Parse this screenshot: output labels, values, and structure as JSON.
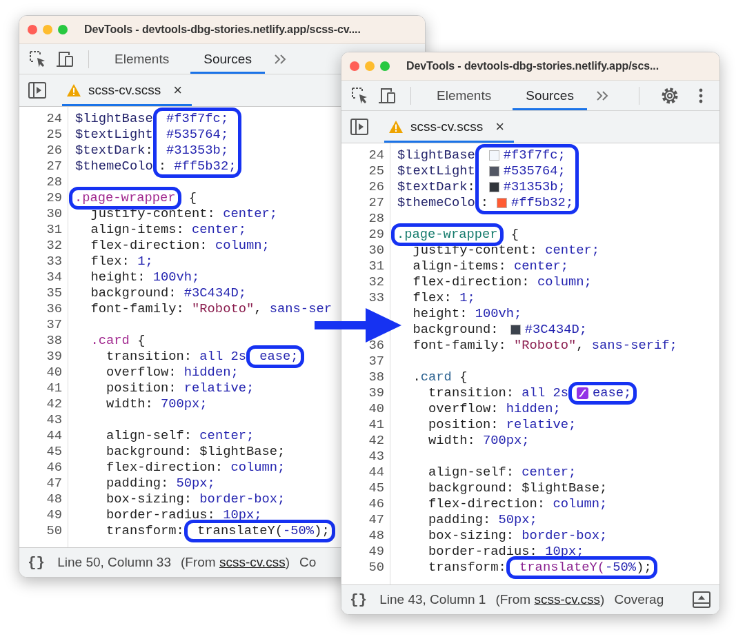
{
  "windows": [
    {
      "title": "DevTools - devtools-dbg-stories.netlify.app/scss-cv....",
      "toolbar_tabs": [
        {
          "label": "Elements",
          "selected": false
        },
        {
          "label": "Sources",
          "selected": true
        }
      ],
      "file_tab": {
        "name": "scss-cv.scss",
        "close": "×"
      },
      "lines": [
        {
          "number": "24",
          "code": [
            {
              "text": "$lightBase",
              "kind": "variable"
            }
          ],
          "highlighted": [
            {
              "text": " #f3f7fc;",
              "kind": "value"
            }
          ]
        },
        {
          "number": "25",
          "code": [
            {
              "text": "$textLight",
              "kind": "variable"
            }
          ],
          "highlighted": [
            {
              "text": " #535764;",
              "kind": "value"
            }
          ]
        },
        {
          "number": "26",
          "code": [
            {
              "text": "$textDark",
              "kind": "variable"
            },
            {
              "text": ":",
              "kind": "plain"
            }
          ],
          "highlighted": [
            {
              "text": " #31353b;",
              "kind": "value"
            }
          ]
        },
        {
          "number": "27",
          "code": [
            {
              "text": "$themeColo",
              "kind": "variable"
            }
          ],
          "highlighted": [
            {
              "text": ": ",
              "kind": "plain"
            },
            {
              "text": "#ff5b32;",
              "kind": "value"
            }
          ]
        },
        {
          "number": "28"
        },
        {
          "number": "29",
          "highlighted": [
            {
              "text": ".page-wrapper",
              "kind": "selector"
            }
          ],
          "rest": [
            {
              "text": " {",
              "kind": "plain"
            }
          ]
        },
        {
          "number": "30",
          "code": [
            {
              "text": "  justify-content: ",
              "kind": "plain"
            },
            {
              "text": "center;",
              "kind": "value"
            }
          ]
        },
        {
          "number": "31",
          "code": [
            {
              "text": "  align-items: ",
              "kind": "plain"
            },
            {
              "text": "center;",
              "kind": "value"
            }
          ]
        },
        {
          "number": "32",
          "code": [
            {
              "text": "  flex-direction: ",
              "kind": "plain"
            },
            {
              "text": "column;",
              "kind": "value"
            }
          ]
        },
        {
          "number": "33",
          "code": [
            {
              "text": "  flex: ",
              "kind": "plain"
            },
            {
              "text": "1;",
              "kind": "value"
            }
          ]
        },
        {
          "number": "34",
          "code": [
            {
              "text": "  height: ",
              "kind": "plain"
            },
            {
              "text": "100vh;",
              "kind": "value"
            }
          ]
        },
        {
          "number": "35",
          "code": [
            {
              "text": "  background: ",
              "kind": "plain"
            },
            {
              "text": "#3C434D;",
              "kind": "value"
            }
          ]
        },
        {
          "number": "36",
          "code": [
            {
              "text": "  font-family: ",
              "kind": "plain"
            },
            {
              "text": "\"Roboto\"",
              "kind": "string"
            },
            {
              "text": ", ",
              "kind": "plain"
            },
            {
              "text": "sans-ser",
              "kind": "value"
            }
          ]
        },
        {
          "number": "37"
        },
        {
          "number": "38",
          "code": [
            {
              "text": "  .card",
              "kind": "selector"
            },
            {
              "text": " {",
              "kind": "plain"
            }
          ]
        },
        {
          "number": "39",
          "code": [
            {
              "text": "    transition: ",
              "kind": "plain"
            },
            {
              "text": "all 2s",
              "kind": "value"
            }
          ],
          "highlighted": [
            {
              "text": " ease;",
              "kind": "value"
            }
          ]
        },
        {
          "number": "40",
          "code": [
            {
              "text": "    overflow: ",
              "kind": "plain"
            },
            {
              "text": "hidden;",
              "kind": "value"
            }
          ]
        },
        {
          "number": "41",
          "code": [
            {
              "text": "    position: ",
              "kind": "plain"
            },
            {
              "text": "relative;",
              "kind": "value"
            }
          ]
        },
        {
          "number": "42",
          "code": [
            {
              "text": "    width: ",
              "kind": "plain"
            },
            {
              "text": "700px;",
              "kind": "value"
            }
          ]
        },
        {
          "number": "43"
        },
        {
          "number": "44",
          "code": [
            {
              "text": "    align-self: ",
              "kind": "plain"
            },
            {
              "text": "center;",
              "kind": "value"
            }
          ]
        },
        {
          "number": "45",
          "code": [
            {
              "text": "    background: $lightBase;",
              "kind": "plain"
            }
          ]
        },
        {
          "number": "46",
          "code": [
            {
              "text": "    flex-direction: ",
              "kind": "plain"
            },
            {
              "text": "column;",
              "kind": "value"
            }
          ]
        },
        {
          "number": "47",
          "code": [
            {
              "text": "    padding: ",
              "kind": "plain"
            },
            {
              "text": "50px;",
              "kind": "value"
            }
          ]
        },
        {
          "number": "48",
          "code": [
            {
              "text": "    box-sizing: ",
              "kind": "plain"
            },
            {
              "text": "border-box;",
              "kind": "value"
            }
          ]
        },
        {
          "number": "49",
          "code": [
            {
              "text": "    border-radius: ",
              "kind": "plain"
            },
            {
              "text": "10px;",
              "kind": "value"
            }
          ]
        },
        {
          "number": "50",
          "code": [
            {
              "text": "    transform:",
              "kind": "plain"
            }
          ],
          "highlighted": [
            {
              "text": " translateY(",
              "kind": "plain"
            },
            {
              "text": "-50%",
              "kind": "value"
            },
            {
              "text": ");",
              "kind": "plain"
            }
          ]
        }
      ],
      "status_bar": {
        "pretty_print": "{}",
        "position": "Line 50, Column 33",
        "source_before": "(From ",
        "source_link": "scss-cv.css",
        "source_after": ")",
        "coverage": "Co"
      }
    },
    {
      "title": "DevTools - devtools-dbg-stories.netlify.app/scs...",
      "toolbar_tabs": [
        {
          "label": "Elements",
          "selected": false
        },
        {
          "label": "Sources",
          "selected": true
        }
      ],
      "settings_button": true,
      "more_button": true,
      "file_tab": {
        "name": "scss-cv.scss",
        "close": "×"
      },
      "lines": [
        {
          "number": "24",
          "code": [
            {
              "text": "$lightBase",
              "kind": "variable"
            }
          ],
          "highlighted": [
            {
              "kind": "swatch",
              "color": "#f3f7fc"
            },
            {
              "text": "#f3f7fc;",
              "kind": "value"
            }
          ]
        },
        {
          "number": "25",
          "code": [
            {
              "text": "$textLight",
              "kind": "variable"
            }
          ],
          "highlighted": [
            {
              "kind": "swatch",
              "color": "#535764"
            },
            {
              "text": "#535764;",
              "kind": "value"
            }
          ]
        },
        {
          "number": "26",
          "code": [
            {
              "text": "$textDark",
              "kind": "variable"
            },
            {
              "text": ":",
              "kind": "plain"
            }
          ],
          "highlighted": [
            {
              "kind": "swatch",
              "color": "#31353b"
            },
            {
              "text": "#31353b;",
              "kind": "value"
            }
          ]
        },
        {
          "number": "27",
          "code": [
            {
              "text": "$themeColo",
              "kind": "variable"
            }
          ],
          "highlighted": [
            {
              "text": ":",
              "kind": "plain"
            },
            {
              "kind": "swatch",
              "color": "#ff5b32"
            },
            {
              "text": "#ff5b32;",
              "kind": "value"
            }
          ]
        },
        {
          "number": "28"
        },
        {
          "number": "29",
          "highlighted": [
            {
              "text": ".page-wrapper",
              "kind": "selector-alt"
            }
          ],
          "rest": [
            {
              "text": " {",
              "kind": "plain"
            }
          ]
        },
        {
          "number": "30",
          "code": [
            {
              "text": "  justify-content: ",
              "kind": "plain"
            },
            {
              "text": "center;",
              "kind": "value"
            }
          ]
        },
        {
          "number": "31",
          "code": [
            {
              "text": "  align-items: ",
              "kind": "plain"
            },
            {
              "text": "center;",
              "kind": "value"
            }
          ]
        },
        {
          "number": "32",
          "code": [
            {
              "text": "  flex-direction: ",
              "kind": "plain"
            },
            {
              "text": "column;",
              "kind": "value"
            }
          ]
        },
        {
          "number": "33",
          "code": [
            {
              "text": "  flex: ",
              "kind": "plain"
            },
            {
              "text": "1;",
              "kind": "value"
            }
          ]
        },
        {
          "code": [
            {
              "text": "  height: ",
              "kind": "plain"
            },
            {
              "text": "100vh;",
              "kind": "value"
            }
          ]
        },
        {
          "code": [
            {
              "text": "  background: ",
              "kind": "plain"
            },
            {
              "kind": "swatch",
              "color": "#3c434d"
            },
            {
              "text": "#3C434D;",
              "kind": "value"
            }
          ]
        },
        {
          "number": "36",
          "code": [
            {
              "text": "  font-family: ",
              "kind": "plain"
            },
            {
              "text": "\"Roboto\"",
              "kind": "string"
            },
            {
              "text": ", ",
              "kind": "plain"
            },
            {
              "text": "sans-serif;",
              "kind": "value"
            }
          ]
        },
        {
          "number": "37"
        },
        {
          "number": "38",
          "code": [
            {
              "text": "  .",
              "kind": "plain"
            },
            {
              "text": "card",
              "kind": "tag"
            },
            {
              "text": " {",
              "kind": "plain"
            }
          ]
        },
        {
          "number": "39",
          "code": [
            {
              "text": "    transition: ",
              "kind": "plain"
            },
            {
              "text": "all 2s",
              "kind": "value"
            }
          ],
          "highlighted": [
            {
              "kind": "easing"
            },
            {
              "text": "ease;",
              "kind": "value"
            }
          ]
        },
        {
          "number": "40",
          "code": [
            {
              "text": "    overflow: ",
              "kind": "plain"
            },
            {
              "text": "hidden;",
              "kind": "value"
            }
          ]
        },
        {
          "number": "41",
          "code": [
            {
              "text": "    position: ",
              "kind": "plain"
            },
            {
              "text": "relative;",
              "kind": "value"
            }
          ]
        },
        {
          "number": "42",
          "code": [
            {
              "text": "    width: ",
              "kind": "plain"
            },
            {
              "text": "700px;",
              "kind": "value"
            }
          ]
        },
        {
          "number": "43"
        },
        {
          "number": "44",
          "code": [
            {
              "text": "    align-self: ",
              "kind": "plain"
            },
            {
              "text": "center;",
              "kind": "value"
            }
          ]
        },
        {
          "number": "45",
          "code": [
            {
              "text": "    background: $lightBase;",
              "kind": "plain"
            }
          ]
        },
        {
          "number": "46",
          "code": [
            {
              "text": "    flex-direction: ",
              "kind": "plain"
            },
            {
              "text": "column;",
              "kind": "value"
            }
          ]
        },
        {
          "number": "47",
          "code": [
            {
              "text": "    padding: ",
              "kind": "plain"
            },
            {
              "text": "50px;",
              "kind": "value"
            }
          ]
        },
        {
          "number": "48",
          "code": [
            {
              "text": "    box-sizing: ",
              "kind": "plain"
            },
            {
              "text": "border-box;",
              "kind": "value"
            }
          ]
        },
        {
          "number": "49",
          "code": [
            {
              "text": "    border-radius: ",
              "kind": "plain"
            },
            {
              "text": "10px;",
              "kind": "value"
            }
          ]
        },
        {
          "number": "50",
          "code": [
            {
              "text": "    transform:",
              "kind": "plain"
            }
          ],
          "highlighted": [
            {
              "text": " translateY(",
              "kind": "function"
            },
            {
              "text": "-50%",
              "kind": "value"
            },
            {
              "text": ");",
              "kind": "plain"
            }
          ]
        }
      ],
      "status_bar": {
        "pretty_print": "{}",
        "position": "Line 43, Column 1",
        "source_before": "(From ",
        "source_link": "scss-cv.css",
        "source_after": ")",
        "coverage": "Coverag",
        "dock_button": true
      }
    }
  ]
}
